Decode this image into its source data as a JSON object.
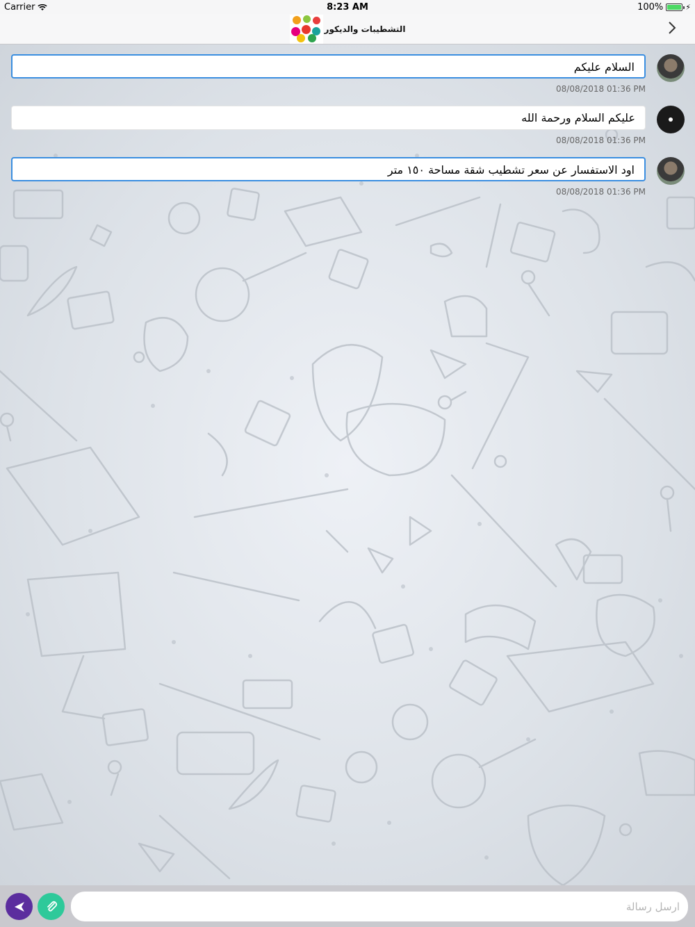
{
  "status_bar": {
    "carrier": "Carrier",
    "time": "8:23 AM",
    "battery": "100%",
    "battery_level": 1.0
  },
  "nav_bar": {
    "title": "التشطيبات والديكور",
    "back_icon": "chevron-right-icon"
  },
  "messages": [
    {
      "text": "السلام عليكم",
      "timestamp": "08/08/2018 01:36 PM",
      "avatar": "user-photo",
      "outlined": true
    },
    {
      "text": "عليكم السلام ورحمة الله",
      "timestamp": "08/08/2018 01:36 PM",
      "avatar": "dark-avatar",
      "outlined": false
    },
    {
      "text": "اود الاستفسار عن سعر تشطيب شقة مساحة ١٥٠ متر",
      "timestamp": "08/08/2018 01:36 PM",
      "avatar": "user-photo",
      "outlined": true
    }
  ],
  "composer": {
    "placeholder": "ارسل رسالة",
    "send_icon": "send-icon",
    "attach_icon": "paperclip-icon"
  },
  "colors": {
    "accent_outline": "#3a8ee0",
    "send_button": "#5b2d9e",
    "attach_button": "#2ec99a"
  }
}
